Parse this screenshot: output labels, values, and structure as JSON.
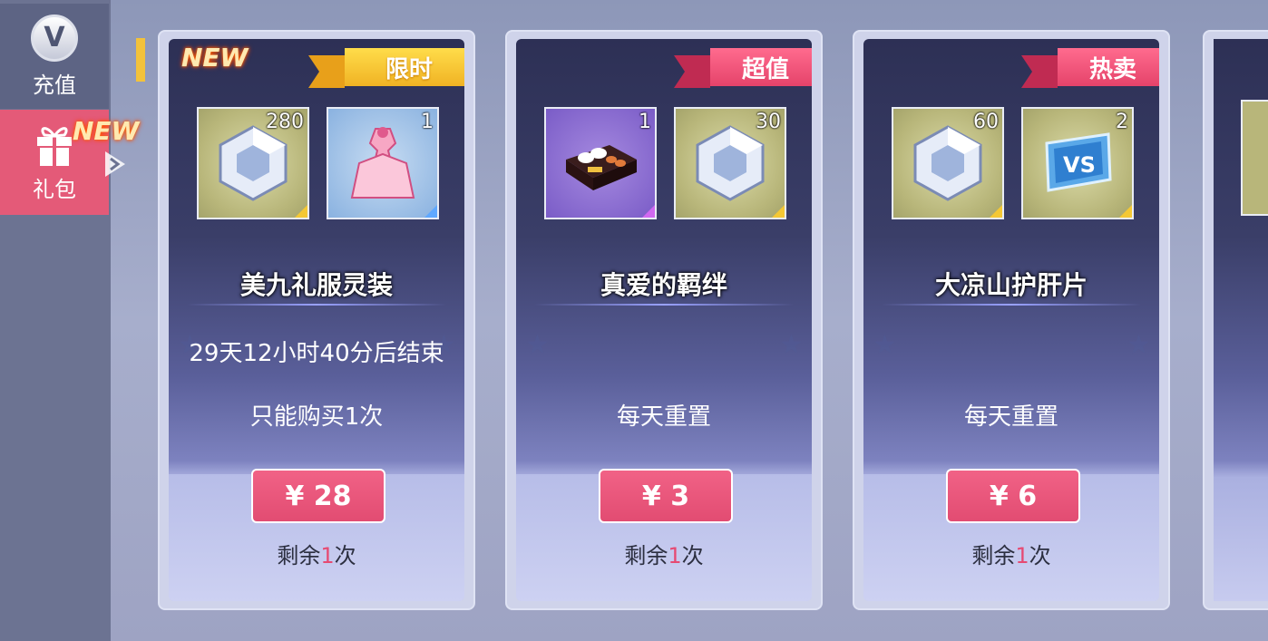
{
  "sidebar": {
    "items": [
      {
        "label": "充值",
        "icon": "v-coin-icon",
        "active": false
      },
      {
        "label": "礼包",
        "icon": "gift-icon",
        "active": true
      }
    ],
    "new_badge": "NEW"
  },
  "cards": [
    {
      "ribbon": "限时",
      "ribbon_color": "#f5c63a",
      "new_badge": "NEW",
      "items": [
        {
          "icon": "crystal-icon",
          "qty": "280",
          "bg": "olive"
        },
        {
          "icon": "pink-dress-icon",
          "qty": "1",
          "bg": "blue"
        }
      ],
      "title": "美九礼服灵装",
      "timer": "29天12小时40分后结束",
      "limit": "只能购买1次",
      "price": "¥ 28",
      "remain_prefix": "剩余",
      "remain_num": "1",
      "remain_suffix": "次"
    },
    {
      "ribbon": "超值",
      "ribbon_color": "#ea4e73",
      "items": [
        {
          "icon": "bento-box-icon",
          "qty": "1",
          "bg": "purple"
        },
        {
          "icon": "crystal-icon",
          "qty": "30",
          "bg": "olive"
        }
      ],
      "title": "真爱的羁绊",
      "reset": "每天重置",
      "price": "¥ 3",
      "remain_prefix": "剩余",
      "remain_num": "1",
      "remain_suffix": "次"
    },
    {
      "ribbon": "热卖",
      "ribbon_color": "#ea4e73",
      "items": [
        {
          "icon": "crystal-icon",
          "qty": "60",
          "bg": "olive"
        },
        {
          "icon": "vs-ticket-icon",
          "qty": "2",
          "bg": "olive"
        }
      ],
      "title": "大凉山护肝片",
      "reset": "每天重置",
      "price": "¥ 6",
      "remain_prefix": "剩余",
      "remain_num": "1",
      "remain_suffix": "次"
    }
  ]
}
